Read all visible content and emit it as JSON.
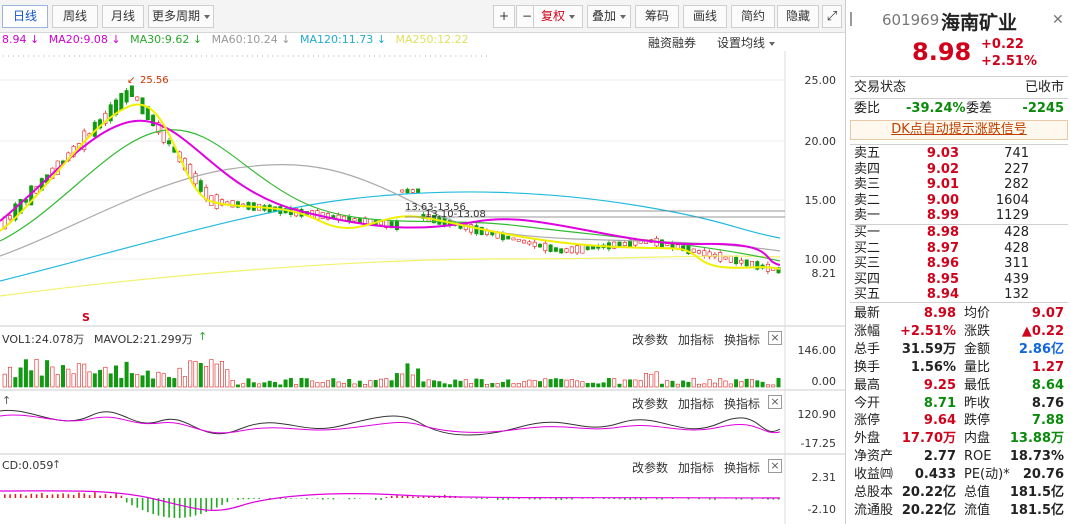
{
  "toolbar": {
    "left_tabs": [
      "日线",
      "周线",
      "月线",
      "更多周期"
    ],
    "icons": [
      "+",
      "−"
    ],
    "right_buttons": [
      "复权",
      "叠加",
      "筹码",
      "画线",
      "简约",
      "隐藏"
    ]
  },
  "ma_legend": [
    {
      "label": "8.94",
      "color": "#d000d0"
    },
    {
      "label": "MA20:9.08",
      "color": "#d000d0"
    },
    {
      "label": "MA30:9.62",
      "color": "#2aa82a"
    },
    {
      "label": "MA60:10.24",
      "color": "#999999"
    },
    {
      "label": "MA120:11.73",
      "color": "#22aacc"
    },
    {
      "label": "MA250:12.22",
      "color": "#e0e060"
    }
  ],
  "main_controls": {
    "margin": "融资融券",
    "setting": "设置均线"
  },
  "price_axis": [
    "25.00",
    "20.00",
    "15.00",
    "10.00",
    "8.21"
  ],
  "annotations": {
    "high": "25.56",
    "box1": "13.63-13.56",
    "box2": "13.10-13.08",
    "s_marker": "S"
  },
  "vol_panel": {
    "vol1": "VOL1:24.078万",
    "vol2": "MAVOL2:21.299万",
    "axis": [
      "146.00",
      "0.00"
    ]
  },
  "macd_panel": {
    "axis": [
      "120.90",
      "-17.25"
    ]
  },
  "cd_panel": {
    "label": "CD:0.059",
    "axis": [
      "2.31",
      "-2.10"
    ]
  },
  "panel_buttons": [
    "改参数",
    "加指标",
    "换指标"
  ],
  "side": {
    "code": "601969",
    "name": "海南矿业",
    "price": "8.98",
    "change": "+0.22",
    "change_pct": "+2.51%",
    "status_label": "交易状态",
    "status_value": "已收市",
    "weibi_label": "委比",
    "weibi_value": "-39.24%",
    "weicha_label": "委差",
    "weicha_value": "-2245",
    "dk_link": "DK点自动提示涨跌信号",
    "sells": [
      {
        "label": "卖五",
        "price": "9.03",
        "vol": "741"
      },
      {
        "label": "卖四",
        "price": "9.02",
        "vol": "227"
      },
      {
        "label": "卖三",
        "price": "9.01",
        "vol": "282"
      },
      {
        "label": "卖二",
        "price": "9.00",
        "vol": "1604"
      },
      {
        "label": "卖一",
        "price": "8.99",
        "vol": "1129"
      }
    ],
    "buys": [
      {
        "label": "买一",
        "price": "8.98",
        "vol": "428"
      },
      {
        "label": "买二",
        "price": "8.97",
        "vol": "428"
      },
      {
        "label": "买三",
        "price": "8.96",
        "vol": "311"
      },
      {
        "label": "买四",
        "price": "8.95",
        "vol": "439"
      },
      {
        "label": "买五",
        "price": "8.94",
        "vol": "132"
      }
    ],
    "stats": [
      {
        "l1": "最新",
        "v1": "8.98",
        "c1": "red",
        "l2": "均价",
        "v2": "9.07",
        "c2": "red"
      },
      {
        "l1": "涨幅",
        "v1": "+2.51%",
        "c1": "red",
        "l2": "涨跌",
        "v2": "▲0.22",
        "c2": "red"
      },
      {
        "l1": "总手",
        "v1": "31.59万",
        "c1": "dark",
        "l2": "金额",
        "v2": "2.86亿",
        "c2": "blue"
      },
      {
        "l1": "换手",
        "v1": "1.56%",
        "c1": "dark",
        "l2": "量比",
        "v2": "1.27",
        "c2": "red"
      },
      {
        "l1": "最高",
        "v1": "9.25",
        "c1": "red",
        "l2": "最低",
        "v2": "8.64",
        "c2": "green"
      },
      {
        "l1": "今开",
        "v1": "8.71",
        "c1": "green",
        "l2": "昨收",
        "v2": "8.76",
        "c2": "dark"
      },
      {
        "l1": "涨停",
        "v1": "9.64",
        "c1": "red",
        "l2": "跌停",
        "v2": "7.88",
        "c2": "green"
      },
      {
        "l1": "外盘",
        "v1": "17.70万",
        "c1": "red",
        "l2": "内盘",
        "v2": "13.88万",
        "c2": "green"
      },
      {
        "l1": "净资产",
        "v1": "2.77",
        "c1": "dark",
        "l2": "ROE",
        "v2": "18.73%",
        "c2": "dark"
      },
      {
        "l1": "收益㈣",
        "v1": "0.433",
        "c1": "dark",
        "l2": "PE(动)*",
        "v2": "20.76",
        "c2": "dark"
      },
      {
        "l1": "总股本",
        "v1": "20.22亿",
        "c1": "dark",
        "l2": "总值",
        "v2": "181.5亿",
        "c2": "dark"
      },
      {
        "l1": "流通股",
        "v1": "20.22亿",
        "c1": "dark",
        "l2": "流值",
        "v2": "181.5亿",
        "c2": "dark"
      }
    ]
  }
}
